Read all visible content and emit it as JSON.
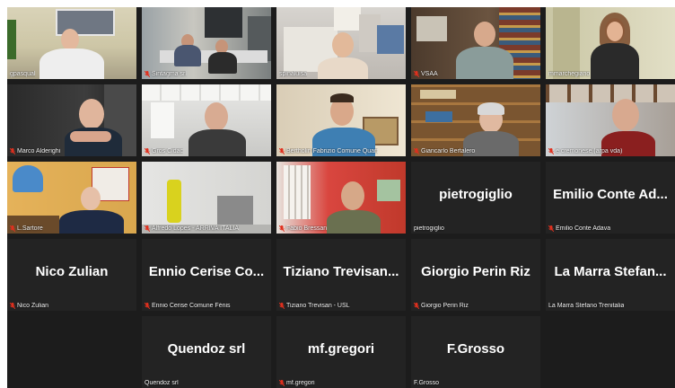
{
  "participants": [
    {
      "name": "gpasqual",
      "muted": false,
      "type": "video"
    },
    {
      "name": "Sintagma srl",
      "muted": true,
      "type": "video"
    },
    {
      "name": "spinaluisa",
      "muted": false,
      "type": "video"
    },
    {
      "name": "VSAA",
      "muted": true,
      "type": "video"
    },
    {
      "name": "mmarchegiano",
      "muted": false,
      "type": "video"
    },
    {
      "name": "Marco Alderighi",
      "muted": true,
      "type": "video"
    },
    {
      "name": "Gros Cidac",
      "muted": true,
      "type": "video"
    },
    {
      "name": "Bertholin Fabrizio Comune Quart",
      "muted": true,
      "type": "video"
    },
    {
      "name": "Giancarlo Bertalero",
      "muted": true,
      "type": "video"
    },
    {
      "name": "e cremonese (arpa vda)",
      "muted": true,
      "type": "video"
    },
    {
      "name": "L.Sartore",
      "muted": true,
      "type": "video"
    },
    {
      "name": "Alfredo Lopes - ARRIVA ITALIA",
      "muted": true,
      "type": "video"
    },
    {
      "name": "Fabio Bressan",
      "muted": true,
      "type": "video"
    },
    {
      "name": "pietrogiglio",
      "muted": false,
      "type": "name",
      "display": "pietrogiglio"
    },
    {
      "name": "Emilio Conte Adava",
      "muted": true,
      "type": "name",
      "display": "Emilio Conte Ad..."
    },
    {
      "name": "Nico Zulian",
      "muted": true,
      "type": "name",
      "display": "Nico Zulian"
    },
    {
      "name": "Ennio Cerise Comune Fénis",
      "muted": true,
      "type": "name",
      "display": "Ennio Cerise Co..."
    },
    {
      "name": "Tiziano Trevisan - USL",
      "muted": true,
      "type": "name",
      "display": "Tiziano  Trevisan..."
    },
    {
      "name": "Giorgio Perin Riz",
      "muted": true,
      "type": "name",
      "display": "Giorgio Perin Riz"
    },
    {
      "name": "La Marra Stefano Trenitalia",
      "muted": false,
      "type": "name",
      "display": "La Marra  Stefan..."
    },
    {
      "name": "",
      "muted": false,
      "type": "empty"
    },
    {
      "name": "Quendoz srl",
      "muted": false,
      "type": "name",
      "display": "Quendoz srl"
    },
    {
      "name": "mf.gregori",
      "muted": true,
      "type": "name",
      "display": "mf.gregori"
    },
    {
      "name": "F.Grosso",
      "muted": false,
      "type": "name",
      "display": "F.Grosso"
    },
    {
      "name": "",
      "muted": false,
      "type": "empty"
    }
  ],
  "colors": {
    "grid_bg": "#1c1c1c",
    "tile_bg": "#232323",
    "muted_icon": "#e0301e",
    "name_text": "#ffffff"
  },
  "icons": {
    "muted": "muted-microphone-icon"
  }
}
